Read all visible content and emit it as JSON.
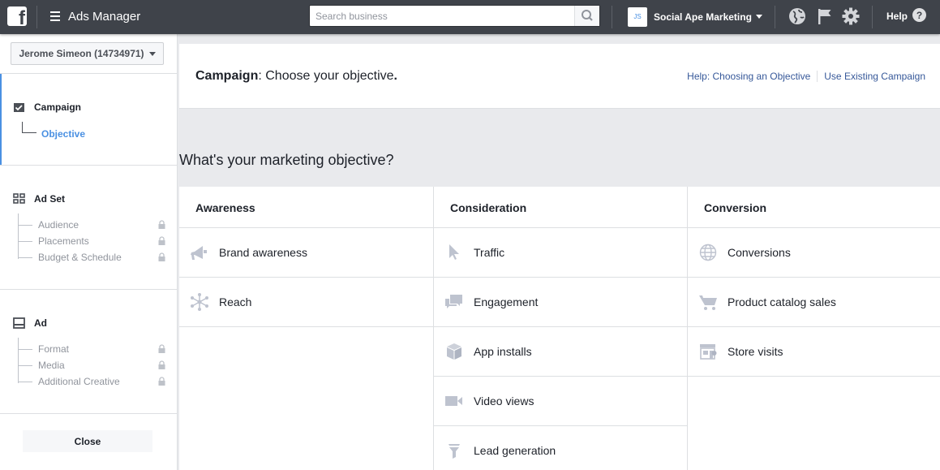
{
  "topbar": {
    "logo_letter": "f",
    "app_title": "Ads Manager",
    "search_placeholder": "Search business",
    "account_initials": "JS",
    "account_name": "Social Ape Marketing",
    "help_label": "Help",
    "help_symbol": "?"
  },
  "sidebar": {
    "account_selector": "Jerome Simeon (14734971)",
    "campaign": {
      "label": "Campaign",
      "sub": "Objective"
    },
    "adset": {
      "label": "Ad Set",
      "items": [
        "Audience",
        "Placements",
        "Budget & Schedule"
      ]
    },
    "ad": {
      "label": "Ad",
      "items": [
        "Format",
        "Media",
        "Additional Creative"
      ]
    },
    "close_label": "Close"
  },
  "header": {
    "title_strong": "Campaign",
    "title_rest": ": Choose your objective",
    "title_end": ".",
    "link_help": "Help: Choosing an Objective",
    "link_existing": "Use Existing Campaign"
  },
  "question": "What's your marketing objective?",
  "columns": [
    {
      "title": "Awareness",
      "items": [
        {
          "label": "Brand awareness",
          "icon": "megaphone-icon"
        },
        {
          "label": "Reach",
          "icon": "reach-icon"
        }
      ]
    },
    {
      "title": "Consideration",
      "items": [
        {
          "label": "Traffic",
          "icon": "cursor-icon"
        },
        {
          "label": "Engagement",
          "icon": "chat-icon"
        },
        {
          "label": "App installs",
          "icon": "box-icon"
        },
        {
          "label": "Video views",
          "icon": "video-icon"
        },
        {
          "label": "Lead generation",
          "icon": "funnel-icon"
        }
      ]
    },
    {
      "title": "Conversion",
      "items": [
        {
          "label": "Conversions",
          "icon": "globe-icon"
        },
        {
          "label": "Product catalog sales",
          "icon": "cart-icon"
        },
        {
          "label": "Store visits",
          "icon": "store-icon"
        }
      ]
    }
  ],
  "colors": {
    "topbar": "#3f434a",
    "accent": "#4a90e2",
    "link": "#365899",
    "icon": "#bec3cf"
  }
}
